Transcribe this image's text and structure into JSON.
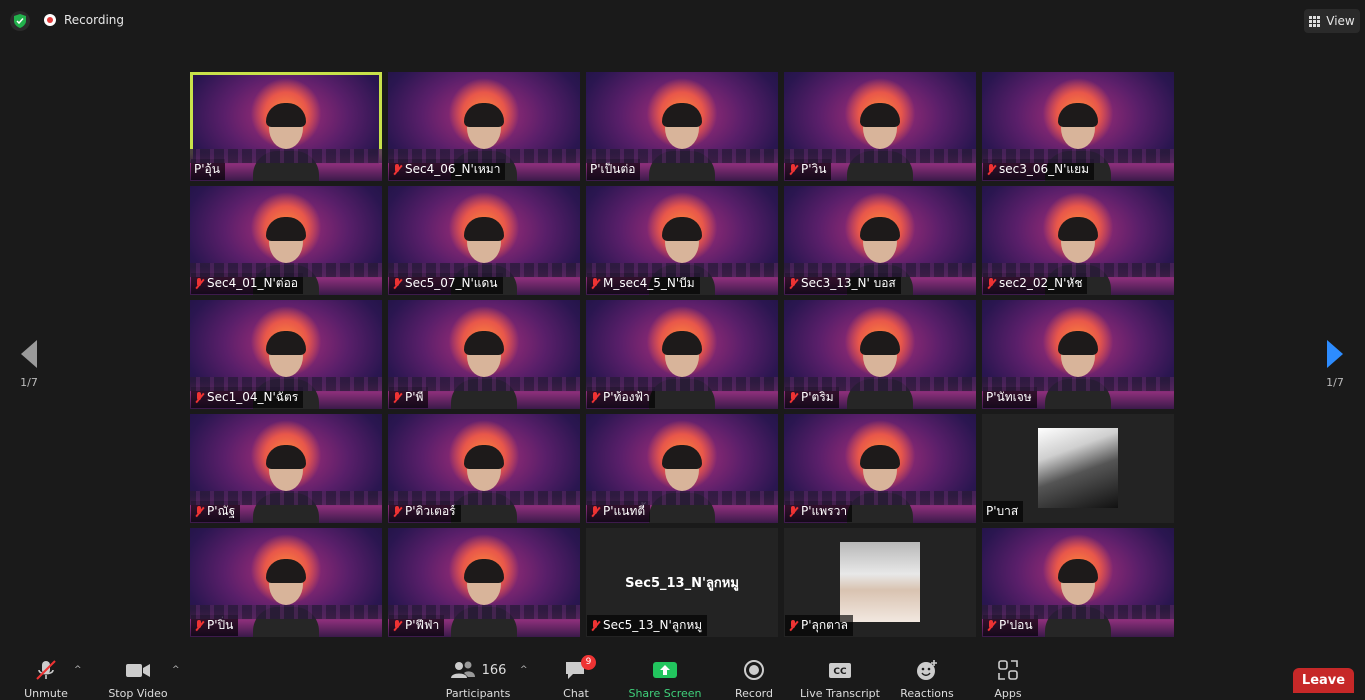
{
  "top": {
    "recording_label": "Recording",
    "view_label": "View"
  },
  "nav": {
    "left_page": "1/7",
    "right_page": "1/7"
  },
  "tiles": [
    {
      "name": "P'อุ้น",
      "muted": false,
      "type": "video",
      "active": true
    },
    {
      "name": "Sec4_06_N'เหมา",
      "muted": true,
      "type": "video"
    },
    {
      "name": "P'เป็นต่อ",
      "muted": false,
      "type": "video"
    },
    {
      "name": "P'วิน",
      "muted": true,
      "type": "video"
    },
    {
      "name": "sec3_06_N'แยม",
      "muted": true,
      "type": "video"
    },
    {
      "name": "Sec4_01_N'ต่ออ",
      "muted": true,
      "type": "video"
    },
    {
      "name": "Sec5_07_N'แดน",
      "muted": true,
      "type": "video"
    },
    {
      "name": "M_sec4_5_N'บีม",
      "muted": true,
      "type": "video"
    },
    {
      "name": "Sec3_13_N' บอส",
      "muted": true,
      "type": "video"
    },
    {
      "name": "sec2_02_N'หัช",
      "muted": true,
      "type": "video"
    },
    {
      "name": "Sec1_04_N'ฉัตร",
      "muted": true,
      "type": "video"
    },
    {
      "name": "P'พี",
      "muted": true,
      "type": "video"
    },
    {
      "name": "P'ท้องฟ้า",
      "muted": true,
      "type": "video"
    },
    {
      "name": "P'ตริม",
      "muted": true,
      "type": "video"
    },
    {
      "name": "P'นัทเจษ",
      "muted": false,
      "type": "video"
    },
    {
      "name": "P'ณัฐ",
      "muted": true,
      "type": "video"
    },
    {
      "name": "P'ดิวเตอร์",
      "muted": true,
      "type": "video"
    },
    {
      "name": "P'แนทตี้",
      "muted": true,
      "type": "video"
    },
    {
      "name": "P'แพรวา",
      "muted": true,
      "type": "video"
    },
    {
      "name": "P'บาส",
      "muted": false,
      "type": "avatar-manga"
    },
    {
      "name": "P'ปิ่น",
      "muted": true,
      "type": "video"
    },
    {
      "name": "P'ฟีฟ่า",
      "muted": true,
      "type": "video"
    },
    {
      "name": "Sec5_13_N'ลูกหมู",
      "muted": true,
      "type": "text",
      "center_text": "Sec5_13_N'ลูกหมู"
    },
    {
      "name": "P'ลุกตาล",
      "muted": true,
      "type": "avatar-photo"
    },
    {
      "name": "P'ปอน",
      "muted": true,
      "type": "video"
    }
  ],
  "toolbar": {
    "unmute": "Unmute",
    "stop_video": "Stop Video",
    "participants": "Participants",
    "participants_count": "166",
    "chat": "Chat",
    "chat_badge": "9",
    "share_screen": "Share Screen",
    "record": "Record",
    "live_transcript": "Live Transcript",
    "reactions": "Reactions",
    "apps": "Apps",
    "leave": "Leave",
    "cc_label": "CC"
  }
}
